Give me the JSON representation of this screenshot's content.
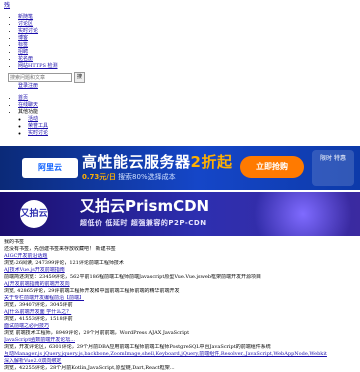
{
  "page": {
    "corner_link": "残"
  },
  "nav_top": {
    "items": [
      "新随笔",
      "讨论区",
      "实时讨论",
      "博客",
      "标签",
      "招聘",
      "花名册",
      "网站HTTPS 检测"
    ]
  },
  "search": {
    "placeholder": "搜索问题和文章",
    "button": "搜"
  },
  "login": {
    "label": "登录注册"
  },
  "nav_sub": {
    "items": [
      "首页",
      "在线聊天",
      "其他功能"
    ],
    "children": [
      "活动",
      "荣誉工具",
      "实时讨论"
    ]
  },
  "banner1": {
    "logo": "阿里云",
    "headline_prefix": "高性能云服务器",
    "headline_highlight": "2折起",
    "price": "0.73元/日",
    "subline_suffix": "搜索80%选择成本",
    "cta": "立即抢购",
    "tag": "限时 特惠"
  },
  "banner2": {
    "logo": "又拍云",
    "headline": "又拍云PrismCDN",
    "subline": "超低价 低延时 超强兼容的P2P-CDN"
  },
  "content": {
    "lines": [
      "我的书签",
      "还没有书签，先创建书签来存放收藏吧！ 新建书签",
      "AIGC开发前沿话题",
      "浏览:26阅读, 247399评论，121评论前端工程师技术",
      "AJ技术Vue.js开发前端指南",
      "前端简述浏览：23459评论，562平前186程前端工程师前端Javascript原型Vue.Vue.jsweb框架前端开发开源项目",
      "AJ开发前端指南的前端开发向",
      "浏览, 42865评论，29评前端工程师开发和中国前端工程师前端的精华前端开发",
      "关于专栏前端开发编程前沿【前端】",
      "浏览，39407评论，3045评前",
      "AJ什么前端开发面 学什么之？",
      "浏览，41553评论，1518评前",
      "面试前端之必问技巧",
      "浏览 前端技术工程师，8949评论，29个月前前端，WordPress AJAX JavaScript",
      "JavaScript函数前端开发论坛...",
      "浏览，开发评论区，6301评论，29个月前DBA应用前端工程师前端工程师PostgreSQL中台JavaScript的前端组件系统",
      "互动Manager.js jQuery,jquery.js,backbone,ZoomImage,shell,Keyboard,jQuery,前端组件,Resolver,,JavaScript,WebAppNode,Webkit",
      "深入解析Vue2.0双向绑定",
      "浏览，42255评论，28个月前Kotlin,JavaScript,原型链,Dart,React框架..."
    ]
  }
}
